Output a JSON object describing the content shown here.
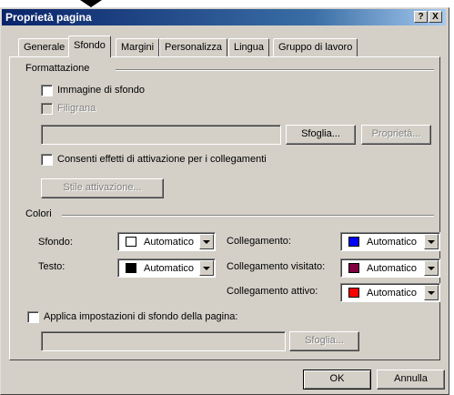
{
  "window": {
    "title": "Proprietà pagina",
    "help_label": "?",
    "close_label": "X"
  },
  "tabs": [
    {
      "label": "Generale"
    },
    {
      "label": "Sfondo"
    },
    {
      "label": "Margini"
    },
    {
      "label": "Personalizza"
    },
    {
      "label": "Lingua"
    },
    {
      "label": "Gruppo di lavoro"
    }
  ],
  "formattazione": {
    "group_label": "Formattazione",
    "immagine_sfondo_label": "Immagine di sfondo",
    "filigrana_label": "Filigrana",
    "file_path_value": "",
    "sfoglia_label": "Sfoglia...",
    "proprieta_label": "Proprietà...",
    "consenti_label": "Consenti effetti di attivazione per i collegamenti",
    "stile_attivazione_label": "Stile attivazione..."
  },
  "colori": {
    "group_label": "Colori",
    "sfondo_label": "Sfondo:",
    "sfondo_value": "Automatico",
    "sfondo_color": "#ffffff",
    "testo_label": "Testo:",
    "testo_value": "Automatico",
    "testo_color": "#000000",
    "collegamento_label": "Collegamento:",
    "collegamento_value": "Automatico",
    "collegamento_color": "#0000ff",
    "visitato_label": "Collegamento visitato:",
    "visitato_value": "Automatico",
    "visitato_color": "#800040",
    "attivo_label": "Collegamento attivo:",
    "attivo_value": "Automatico",
    "attivo_color": "#ff0000"
  },
  "applica": {
    "label": "Applica impostazioni di sfondo della pagina:",
    "file_path_value": "",
    "sfoglia_label": "Sfoglia..."
  },
  "footer": {
    "ok_label": "OK",
    "annulla_label": "Annulla"
  }
}
